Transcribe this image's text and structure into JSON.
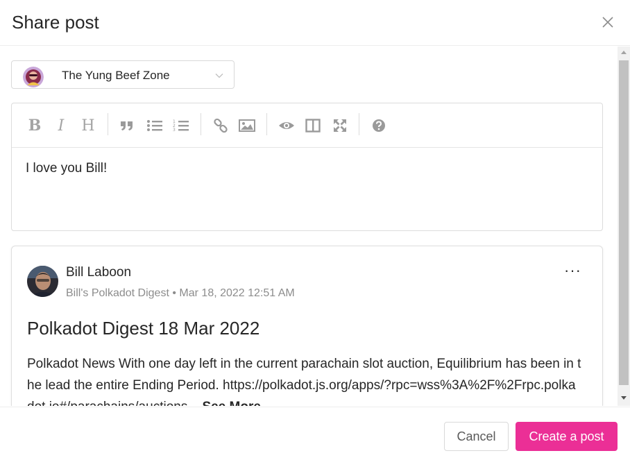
{
  "modal": {
    "title": "Share post"
  },
  "space_select": {
    "selected": "The Yung Beef Zone"
  },
  "editor": {
    "toolbar": [
      "bold-icon",
      "italic-icon",
      "heading-icon",
      "quote-icon",
      "unordered-list-icon",
      "ordered-list-icon",
      "link-icon",
      "image-icon",
      "preview-icon",
      "side-by-side-icon",
      "fullscreen-icon",
      "help-icon"
    ],
    "content": "I love you Bill!"
  },
  "post": {
    "author": "Bill Laboon",
    "space": "Bill's Polkadot Digest",
    "separator": "•",
    "date": "Mar 18, 2022 12:51 AM",
    "more": "···",
    "title": "Polkadot Digest 18 Mar 2022",
    "summary": "Polkadot News With one day left in the current parachain slot auction, Equilibrium has been in the lead the entire Ending Period. https://polkadot.js.org/apps/?rpc=wss%3A%2F%2Frpc.polkadot.io#/parachains/auctions... ",
    "see_more": "See More"
  },
  "footer": {
    "cancel_label": "Cancel",
    "create_label": "Create a post"
  },
  "colors": {
    "primary": "#eb2f96",
    "muted_text": "#8c8c8c",
    "border": "#d9d9d9"
  }
}
